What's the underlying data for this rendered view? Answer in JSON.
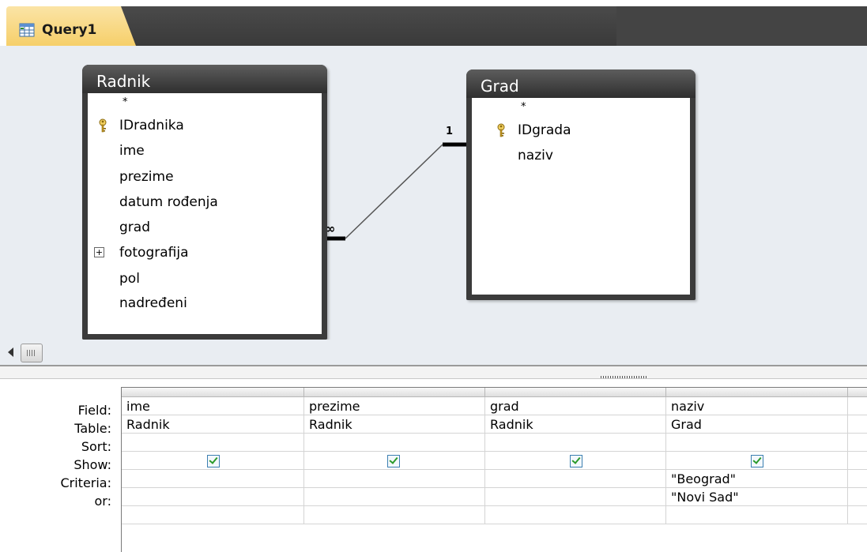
{
  "tab": {
    "label": "Query1",
    "icon": "query-icon"
  },
  "tables": [
    {
      "name": "Radnik",
      "fields": [
        {
          "label": "*"
        },
        {
          "label": "IDradnika",
          "key": true
        },
        {
          "label": "ime"
        },
        {
          "label": "prezime"
        },
        {
          "label": "datum rođenja"
        },
        {
          "label": "grad"
        },
        {
          "label": "fotografija",
          "expand": true
        },
        {
          "label": "pol"
        },
        {
          "label": "nadređeni"
        }
      ]
    },
    {
      "name": "Grad",
      "fields": [
        {
          "label": "*"
        },
        {
          "label": "IDgrada",
          "key": true
        },
        {
          "label": "naziv"
        }
      ]
    }
  ],
  "relationship": {
    "one_label": "1",
    "many_label": "∞"
  },
  "row_labels": [
    "Field:",
    "Table:",
    "Sort:",
    "Show:",
    "Criteria:",
    "or:"
  ],
  "columns": [
    {
      "field": "ime",
      "table": "Radnik",
      "sort": "",
      "show": true,
      "criteria": "",
      "or": ""
    },
    {
      "field": "prezime",
      "table": "Radnik",
      "sort": "",
      "show": true,
      "criteria": "",
      "or": ""
    },
    {
      "field": "grad",
      "table": "Radnik",
      "sort": "",
      "show": true,
      "criteria": "",
      "or": ""
    },
    {
      "field": "naziv",
      "table": "Grad",
      "sort": "",
      "show": true,
      "criteria": "\"Beograd\"",
      "or": "\"Novi Sad\""
    }
  ]
}
